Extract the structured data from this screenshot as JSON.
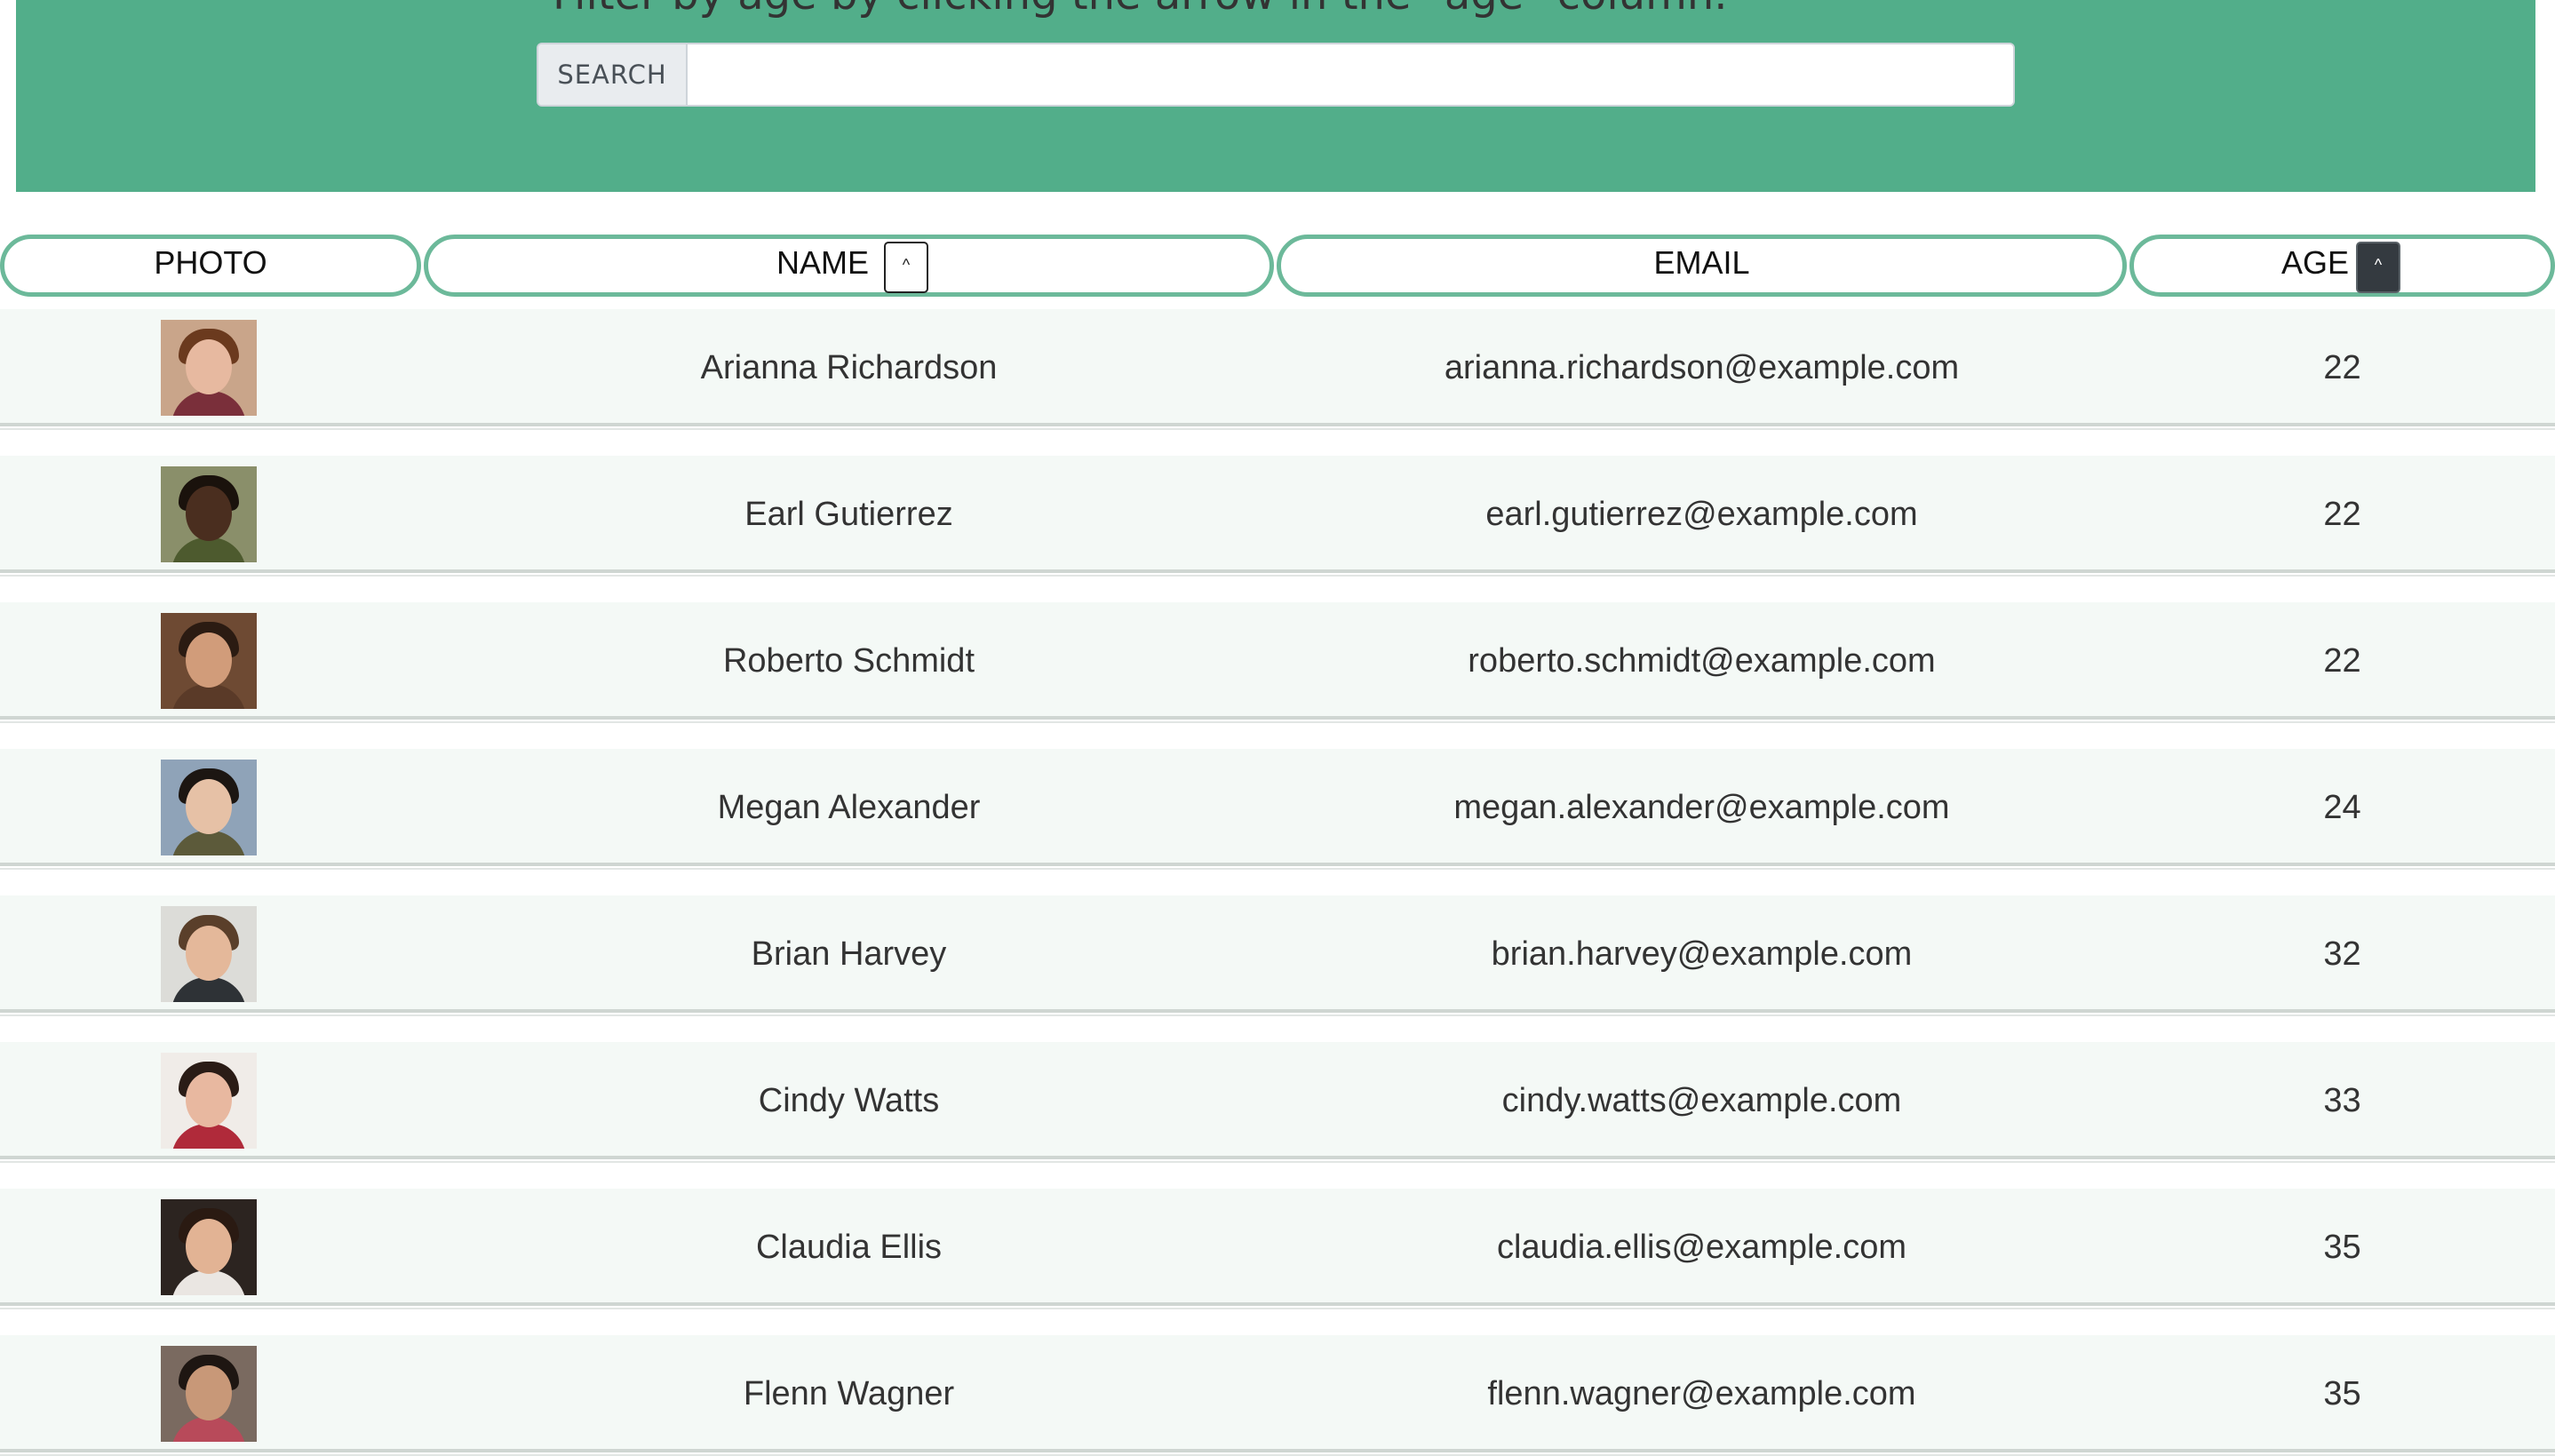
{
  "banner": {
    "text": "Filter by age by clicking the arrow in the \"age\" column.",
    "search_label": "SEARCH",
    "search_value": "",
    "color": "#52ae8a"
  },
  "table": {
    "headers": {
      "photo": "PHOTO",
      "name": "NAME",
      "email": "EMAIL",
      "age": "AGE"
    },
    "sort_glyph": "^",
    "active_sort": "age",
    "rows": [
      {
        "name": "Arianna Richardson",
        "email": "arianna.richardson@example.com",
        "age": "22",
        "photo": {
          "bg": "#c9a58a",
          "hair": "#6b3a1e",
          "skin": "#e7b9a0",
          "shirt": "#7a2f3a"
        }
      },
      {
        "name": "Earl Gutierrez",
        "email": "earl.gutierrez@example.com",
        "age": "22",
        "photo": {
          "bg": "#8a8f6a",
          "hair": "#1a120c",
          "skin": "#4a2e1f",
          "shirt": "#4d5a2e"
        }
      },
      {
        "name": "Roberto Schmidt",
        "email": "roberto.schmidt@example.com",
        "age": "22",
        "photo": {
          "bg": "#6e4a33",
          "hair": "#2b1b12",
          "skin": "#d19c7a",
          "shirt": "#5a3a28"
        }
      },
      {
        "name": "Megan Alexander",
        "email": "megan.alexander@example.com",
        "age": "24",
        "photo": {
          "bg": "#8fa3b8",
          "hair": "#1c1612",
          "skin": "#e6c1a6",
          "shirt": "#5c5a3a"
        }
      },
      {
        "name": "Brian Harvey",
        "email": "brian.harvey@example.com",
        "age": "32",
        "photo": {
          "bg": "#dcdcd8",
          "hair": "#5a3f2a",
          "skin": "#e4b89a",
          "shirt": "#2e3236"
        }
      },
      {
        "name": "Cindy Watts",
        "email": "cindy.watts@example.com",
        "age": "33",
        "photo": {
          "bg": "#f0ece8",
          "hair": "#2a1c16",
          "skin": "#e8b8a0",
          "shirt": "#b02a3a"
        }
      },
      {
        "name": "Claudia Ellis",
        "email": "claudia.ellis@example.com",
        "age": "35",
        "photo": {
          "bg": "#2c2420",
          "hair": "#2a1a12",
          "skin": "#e2b394",
          "shirt": "#eae6e2"
        }
      },
      {
        "name": "Flenn Wagner",
        "email": "flenn.wagner@example.com",
        "age": "35",
        "photo": {
          "bg": "#7a6a60",
          "hair": "#1e1612",
          "skin": "#c89878",
          "shirt": "#b84a5a"
        }
      }
    ]
  }
}
